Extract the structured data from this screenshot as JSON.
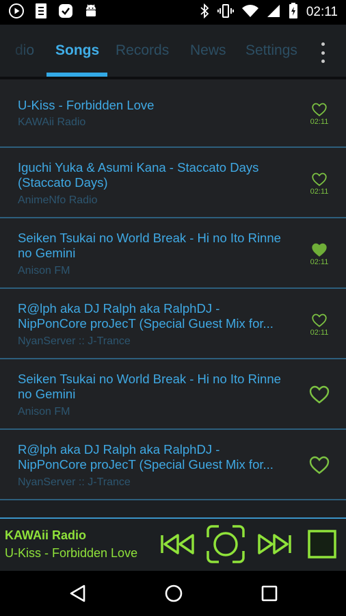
{
  "status_bar": {
    "time": "02:11",
    "icons": [
      "play-circle-icon",
      "app-badge-icon",
      "check-bubble-icon",
      "android-icon",
      "bluetooth-icon",
      "vibrate-icon",
      "wifi-icon",
      "signal-icon",
      "battery-charging-icon"
    ]
  },
  "tabs": [
    {
      "label": "dio",
      "active": false
    },
    {
      "label": "Songs",
      "active": true
    },
    {
      "label": "Records",
      "active": false
    },
    {
      "label": "News",
      "active": false
    },
    {
      "label": "Settings",
      "active": false
    }
  ],
  "songs": [
    {
      "title": "U-Kiss - Forbidden Love",
      "station": "KAWAii Radio",
      "time": "02:11",
      "favorited": false
    },
    {
      "title": "Iguchi Yuka & Asumi Kana - Staccato Days (Staccato Days)",
      "station": "AnimeNfo Radio",
      "time": "02:11",
      "favorited": false
    },
    {
      "title": "Seiken Tsukai no World Break - Hi no Ito Rinne no Gemini",
      "station": "Anison FM",
      "time": "02:11",
      "favorited": true
    },
    {
      "title": "R@lph aka DJ Ralph aka RalphDJ - NipPonCore proJecT (Special Guest Mix for...",
      "station": "NyanServer :: J-Trance",
      "time": "02:11",
      "favorited": false
    },
    {
      "title": "Seiken Tsukai no World Break - Hi no Ito Rinne no Gemini",
      "station": "Anison FM",
      "time": "",
      "favorited": false
    },
    {
      "title": "R@lph aka DJ Ralph aka RalphDJ - NipPonCore proJecT (Special Guest Mix for...",
      "station": "NyanServer :: J-Trance",
      "time": "",
      "favorited": false
    }
  ],
  "now_playing": {
    "station": "KAWAii Radio",
    "song": "U-Kiss - Forbidden Love"
  },
  "colors": {
    "accent": "#40aee8",
    "player_green": "#8fe23a",
    "heart_green": "#7cc242"
  }
}
